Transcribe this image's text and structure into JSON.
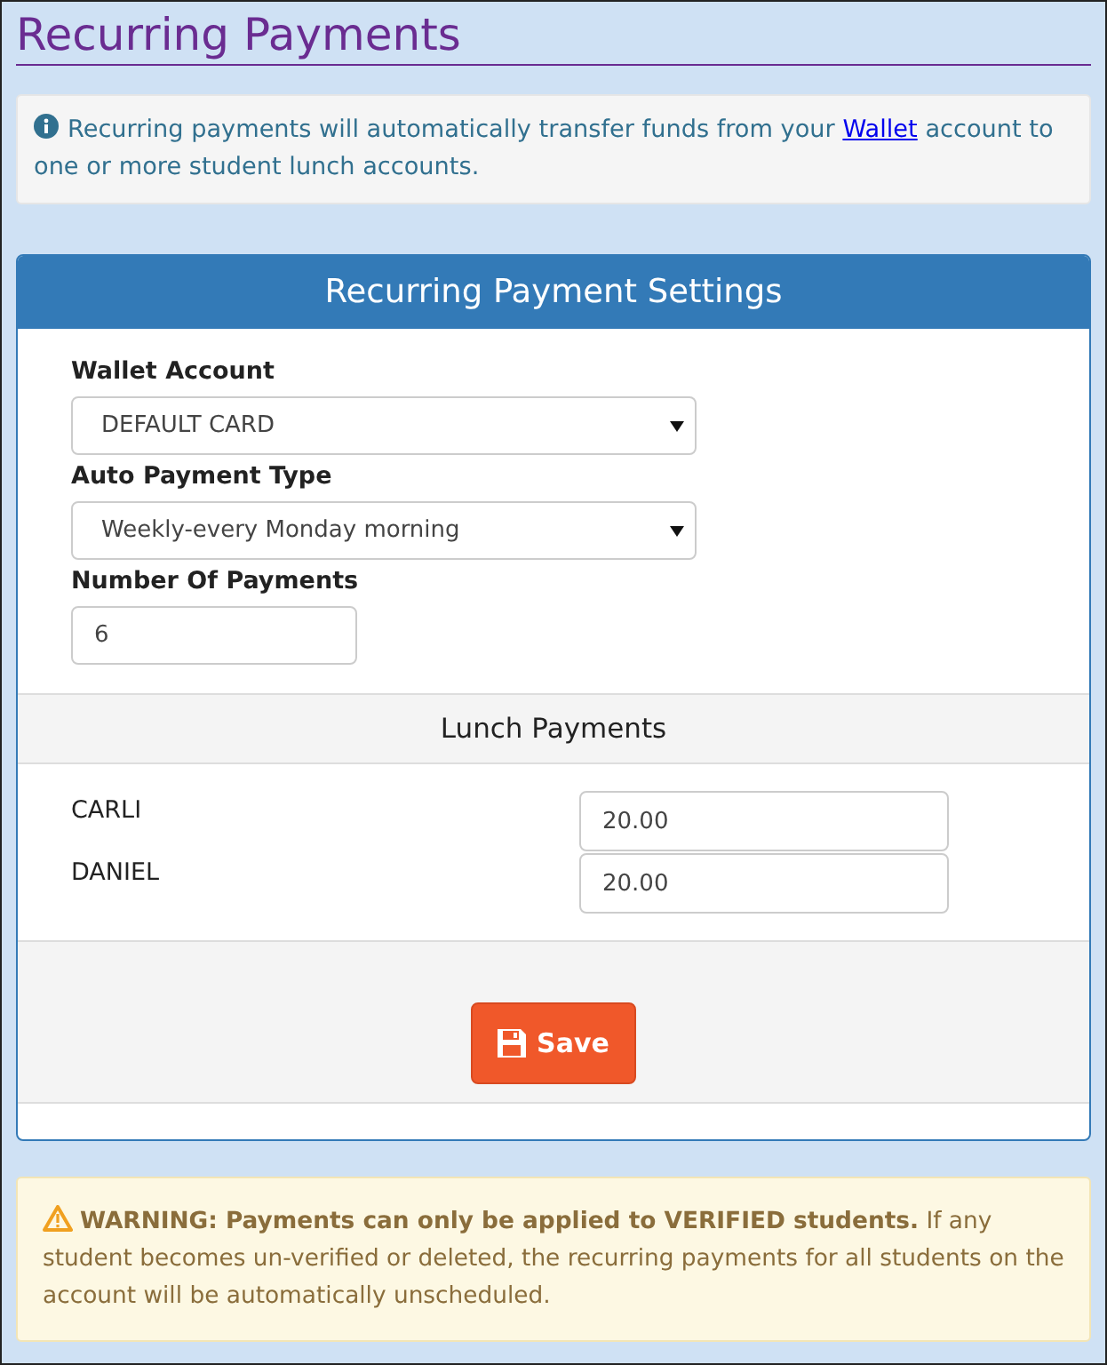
{
  "page_title": "Recurring Payments",
  "info": {
    "before": "Recurring payments will automatically transfer funds from your",
    "link": "Wallet",
    "after": "account to one or more student lunch accounts."
  },
  "panel": {
    "title": "Recurring Payment Settings",
    "fields": [
      {
        "kind": "select",
        "label": "Wallet Account",
        "value": "DEFAULT CARD"
      },
      {
        "kind": "select",
        "label": "Auto Payment Type",
        "value": "Weekly-every Monday morning"
      },
      {
        "kind": "input",
        "label": "Number Of Payments",
        "value": "6"
      }
    ],
    "lunch_title": "Lunch Payments",
    "students": [
      {
        "name": "CARLI",
        "amount": "20.00"
      },
      {
        "name": "DANIEL",
        "amount": "20.00"
      }
    ],
    "save_button": "Save"
  },
  "warning": "**WARNING: Payments can only be applied to VERIFIED students.** If any student becomes un-verified or deleted, the recurring payments for all students on the account will be automatically unscheduled."
}
